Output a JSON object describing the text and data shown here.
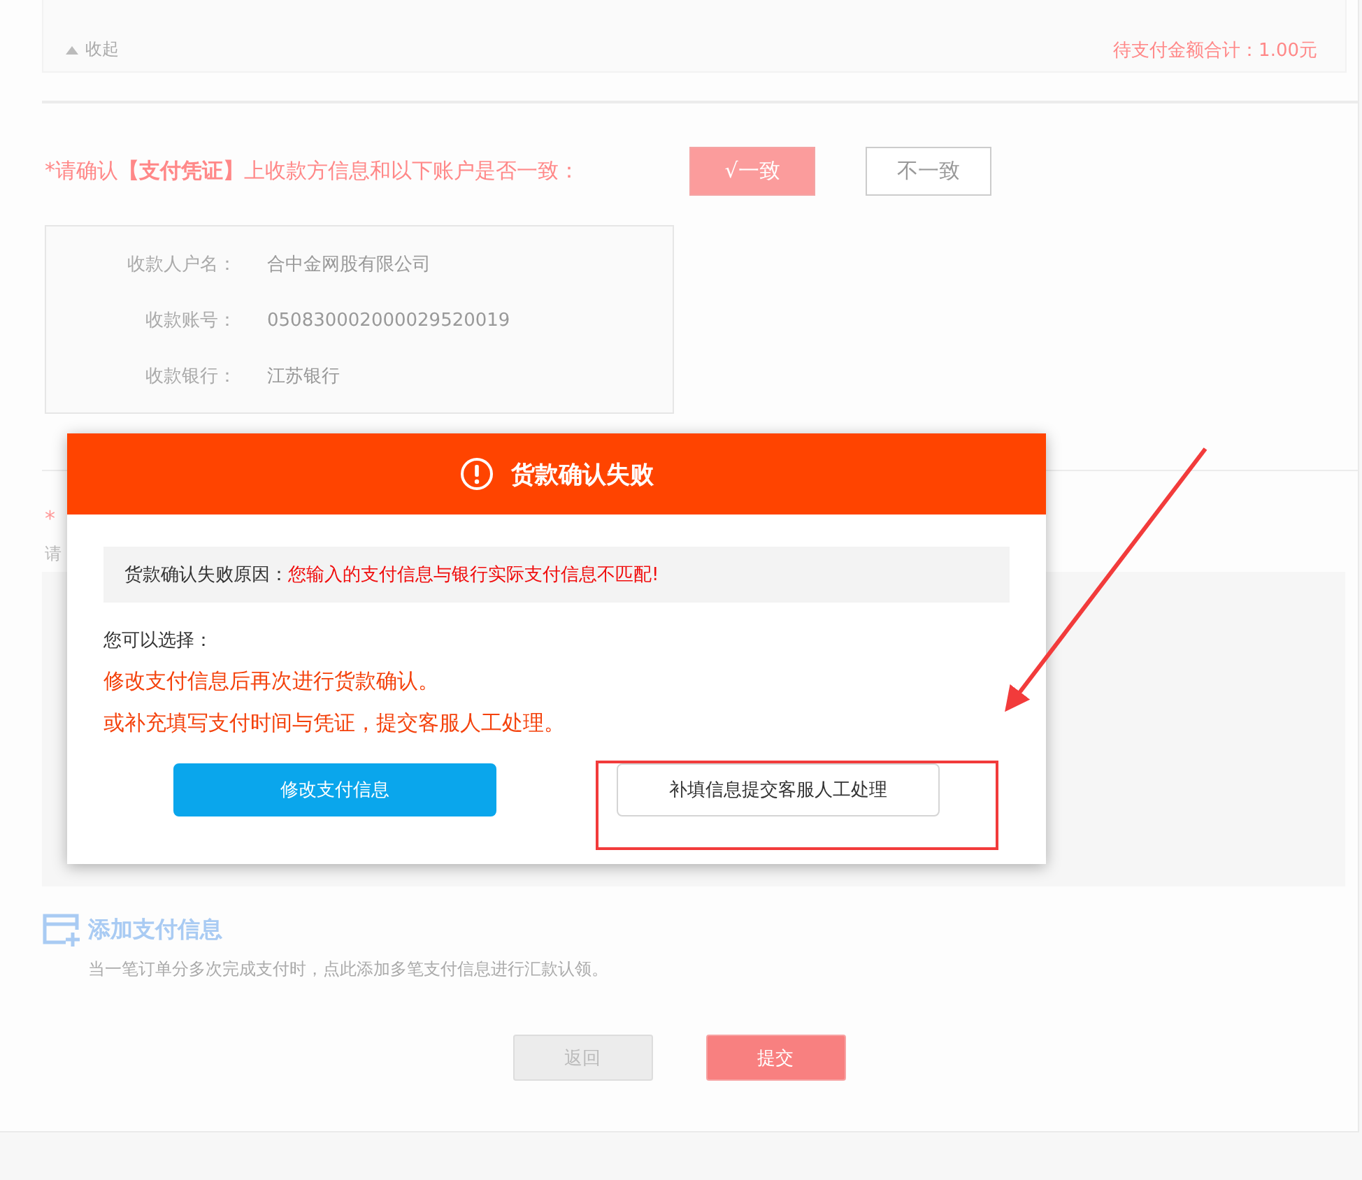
{
  "summary": {
    "collapse": "收起",
    "total": "待支付金额合计：1.00元"
  },
  "confirm": {
    "prompt": "*请确认**【支付凭证】**上收款方信息和以下账户是否一致：",
    "options": [
      {
        "label": "√一致",
        "selected": true
      },
      {
        "label": "不一致",
        "selected": false
      }
    ]
  },
  "account": [
    {
      "label": "收款人户名：",
      "value": "合中金网股有限公司"
    },
    {
      "label": "收款账号：",
      "value": "050830002000029520019"
    },
    {
      "label": "收款银行：",
      "value": "江苏银行"
    }
  ],
  "section_2": {
    "title": "*",
    "hint": "请"
  },
  "add_payment": {
    "title": "添加支付信息",
    "note": "当一笔订单分多次完成支付时，点此添加多笔支付信息进行汇款认领。"
  },
  "buttons": [
    {
      "label": "返回",
      "kind": "secondary"
    },
    {
      "label": "提交",
      "kind": "primary"
    }
  ],
  "dialog": {
    "title": "货款确认失败",
    "reason_label": "货款确认失败原因：",
    "reason": "您输入的支付信息与银行实际支付信息不匹配!",
    "choose": "您可以选择：",
    "options": [
      "修改支付信息后再次进行货款确认。",
      "或补充填写支付时间与凭证，提交客服人工处理。"
    ],
    "buttons": [
      {
        "label": "修改支付信息",
        "kind": "primary"
      },
      {
        "label": "补填信息提交客服人工处理",
        "kind": "default"
      }
    ]
  }
}
